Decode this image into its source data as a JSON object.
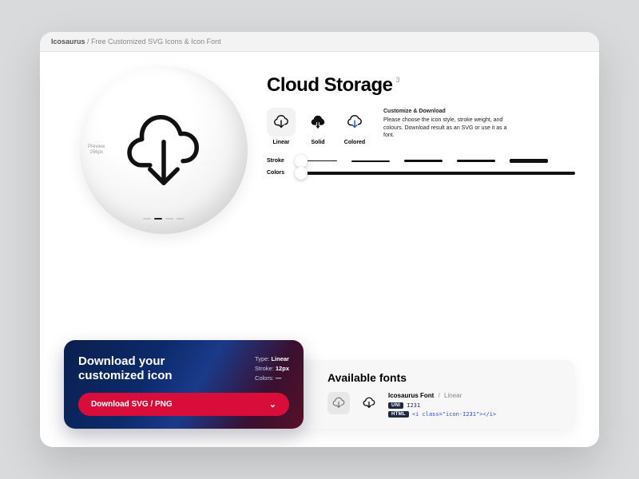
{
  "titlebar": {
    "brand": "Icosaurus",
    "tagline": "Free Customized SVG Icons & Icon Font"
  },
  "icon": {
    "name": "Cloud Storage",
    "count_sup": "3"
  },
  "preview": {
    "label_top": "Preview",
    "label_size": "256px"
  },
  "styles": {
    "desc_title": "Customize & Download",
    "desc_body": "Please choose the icon style, stroke weight, and colours. Download result as an SVG or use it as a font.",
    "items": [
      {
        "label": "Linear"
      },
      {
        "label": "Solid"
      },
      {
        "label": "Colored"
      }
    ]
  },
  "controls": {
    "stroke_label": "Stroke",
    "colors_label": "Colors"
  },
  "download": {
    "title_line1": "Download your",
    "title_line2": "customized icon",
    "meta": {
      "type_key": "Type:",
      "type_val": "Linear",
      "stroke_key": "Stroke:",
      "stroke_val": "12px",
      "colors_key": "Colors:",
      "colors_val": "—"
    },
    "button": "Download SVG / PNG"
  },
  "fonts": {
    "title": "Available fonts",
    "font_name": "Icosaurus Font",
    "variant": "Linear",
    "uni_tag": "UNI",
    "uni_val": "I231",
    "html_tag": "HTML",
    "html_val": "<i class=\"icon-I231\"></i>"
  }
}
